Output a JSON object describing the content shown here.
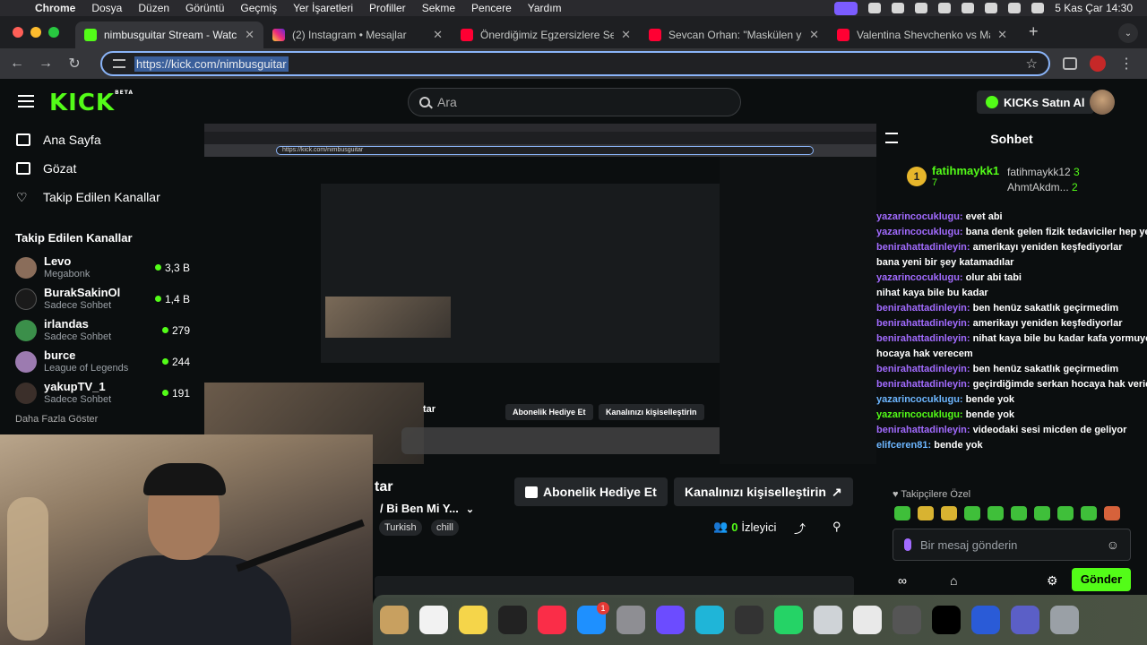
{
  "menubar": {
    "app": "Chrome",
    "items": [
      "Dosya",
      "Düzen",
      "Görüntü",
      "Geçmiş",
      "Yer İşaretleri",
      "Profiller",
      "Sekme",
      "Pencere",
      "Yardım"
    ],
    "clock": "5 Kas Çar  14:30"
  },
  "tabs": [
    {
      "title": "nimbusguitar Stream - Watch",
      "favicon": "kick"
    },
    {
      "title": "(2) Instagram • Mesajlar",
      "favicon": "instagram"
    },
    {
      "title": "Önerdiğimiz Egzersizlere Seri",
      "favicon": "youtube"
    },
    {
      "title": "Sevcan Orhan: \"Maskülen ya",
      "favicon": "youtube"
    },
    {
      "title": "Valentina Shevchenko vs Man",
      "favicon": "youtube"
    }
  ],
  "address": {
    "url": "https://kick.com/nimbusguitar"
  },
  "kick": {
    "logo": "KICK",
    "logo_beta": "BETA",
    "search_placeholder": "Ara",
    "buy_kicks": "KICKs Satın Al"
  },
  "sidebar": {
    "nav": [
      {
        "label": "Ana Sayfa",
        "icon": "home-icon"
      },
      {
        "label": "Gözat",
        "icon": "browse-icon"
      },
      {
        "label": "Takip Edilen Kanallar",
        "icon": "heart-icon"
      }
    ],
    "section_title": "Takip Edilen Kanallar",
    "channels": [
      {
        "name": "Levo",
        "category": "Megabonk",
        "viewers": "3,3 B",
        "color": "#8a6d5a"
      },
      {
        "name": "BurakSakinOl",
        "category": "Sadece Sohbet",
        "viewers": "1,4 B",
        "color": "#1a1a1a"
      },
      {
        "name": "irlandas",
        "category": "Sadece Sohbet",
        "viewers": "279",
        "color": "#3b8f4a"
      },
      {
        "name": "burce",
        "category": "League of Legends",
        "viewers": "244",
        "color": "#9c7bb0"
      },
      {
        "name": "yakupTV_1",
        "category": "Sadece Sohbet",
        "viewers": "191",
        "color": "#3b2f2a"
      }
    ],
    "show_more": "Daha Fazla Göster"
  },
  "stream": {
    "title_fragment": "tar",
    "category_fragment": "/ Bi Ben Mi Y...",
    "tags": [
      "Turkish",
      "chill"
    ],
    "gift_sub": "Abonelik Hediye Et",
    "customize": "Kanalınızı kişiselleştirin",
    "viewers_count": "0",
    "viewers_label": "İzleyici"
  },
  "chat": {
    "title": "Sohbet",
    "pinned": [
      {
        "rank": "1",
        "name": "fatihmaykk1",
        "count": "7"
      }
    ],
    "pinned_side": [
      {
        "name": "fatihmaykk12",
        "count": "3"
      },
      {
        "name": "AhmtAkdm...",
        "count": "2"
      }
    ],
    "messages": [
      {
        "user": "yazarincocuklugu:",
        "text": "evet abi",
        "color": "p"
      },
      {
        "user": "yazarincocuklugu:",
        "text": "bana denk gelen fizik tedaviciler hep yeni",
        "color": "p"
      },
      {
        "user": "benirahattadinleyin:",
        "text": "amerikayı yeniden keşfediyorlar",
        "color": "p"
      },
      {
        "user": "",
        "text": "bana yeni bir şey katamadılar",
        "color": "p"
      },
      {
        "user": "yazarincocuklugu:",
        "text": "olur abi tabi",
        "color": "p"
      },
      {
        "user": "",
        "text": "nihat kaya bile bu kadar",
        "color": "p"
      },
      {
        "user": "benirahattadinleyin:",
        "text": "ben henüz sakatlık geçirmedim",
        "color": "p"
      },
      {
        "user": "benirahattadinleyin:",
        "text": "amerikayı yeniden keşfediyorlar",
        "color": "p"
      },
      {
        "user": "benirahattadinleyin:",
        "text": "nihat kaya bile bu kadar kafa yormuyordur bu",
        "color": "p"
      },
      {
        "user": "",
        "text": "hocaya hak verecem",
        "color": "p"
      },
      {
        "user": "benirahattadinleyin:",
        "text": "ben henüz sakatlık geçirmedim",
        "color": "p"
      },
      {
        "user": "benirahattadinleyin:",
        "text": "geçirdiğimde serkan hocaya hak vericem",
        "color": "p"
      },
      {
        "user": "yazarincocuklugu:",
        "text": "bende yok",
        "color": "b"
      },
      {
        "user": "yazarincocuklugu:",
        "text": "bende yok",
        "color": "g"
      },
      {
        "user": "benirahattadinleyin:",
        "text": "videodaki sesi micden de geliyor",
        "color": "p"
      },
      {
        "user": "elifceren81:",
        "text": "bende yok",
        "color": "b"
      }
    ],
    "followers_only": "Takipçilere Özel",
    "input_placeholder": "Bir mesaj gönderin",
    "send": "Gönder"
  },
  "dock": {
    "apps": [
      "photos",
      "reminders",
      "notes",
      "apple-tv",
      "music",
      "app-store",
      "system-settings",
      "imovie",
      "canva",
      "obs",
      "whatsapp",
      "utility",
      "chrome",
      "calculator",
      "capcut",
      "quicktime",
      "teams",
      "trash"
    ],
    "app_store_badge": "1"
  }
}
